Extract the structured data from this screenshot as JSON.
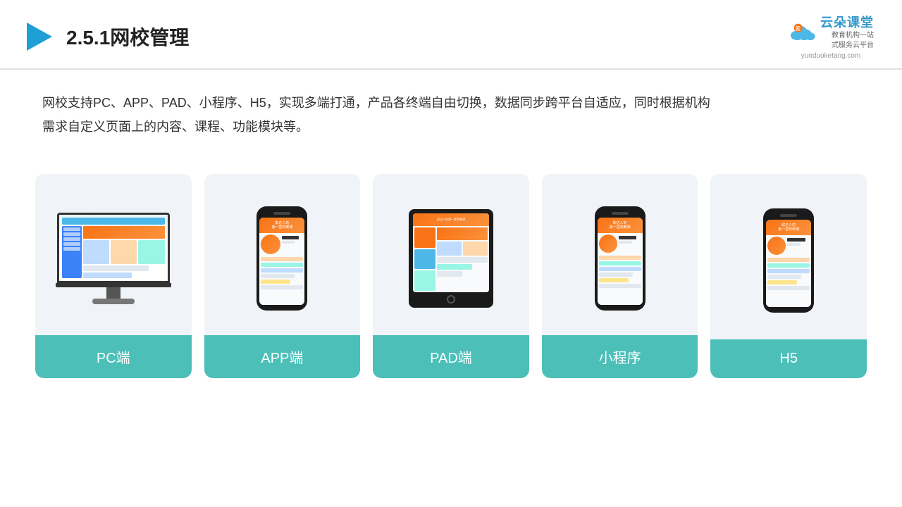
{
  "header": {
    "title": "2.5.1网校管理",
    "logo_main": "云朵课堂",
    "logo_url": "yunduoketang.com",
    "logo_tagline_line1": "教育机构一站",
    "logo_tagline_line2": "式服务云平台"
  },
  "description": {
    "text_line1": "网校支持PC、APP、PAD、小程序、H5，实现多端打通，产品各终端自由切换，数据同步跨平台自适应，同时根据机构",
    "text_line2": "需求自定义页面上的内容、课程、功能模块等。"
  },
  "cards": [
    {
      "id": "pc",
      "label": "PC端"
    },
    {
      "id": "app",
      "label": "APP端"
    },
    {
      "id": "pad",
      "label": "PAD端"
    },
    {
      "id": "miniprogram",
      "label": "小程序"
    },
    {
      "id": "h5",
      "label": "H5"
    }
  ]
}
